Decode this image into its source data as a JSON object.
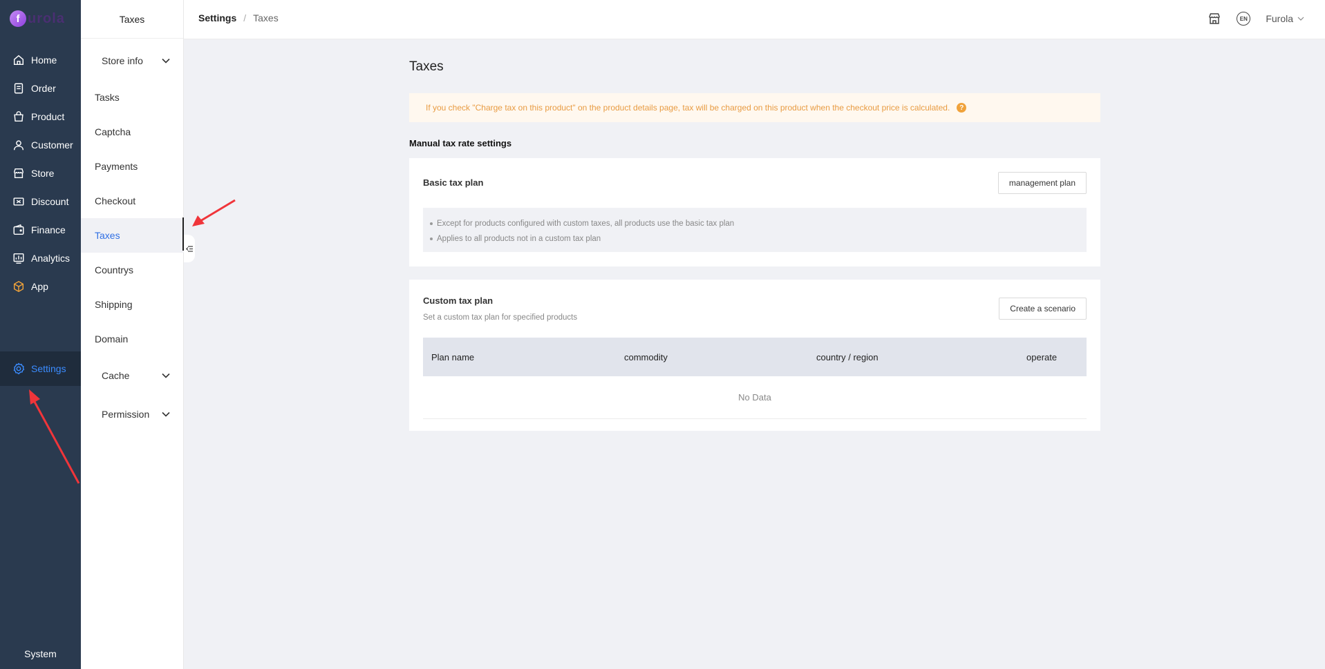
{
  "brand": {
    "logo_letter": "f",
    "logo_text": "urola"
  },
  "nav": {
    "items": [
      {
        "label": "Home",
        "icon": "home-icon"
      },
      {
        "label": "Order",
        "icon": "order-icon"
      },
      {
        "label": "Product",
        "icon": "bag-icon"
      },
      {
        "label": "Customer",
        "icon": "user-icon"
      },
      {
        "label": "Store",
        "icon": "store-icon"
      },
      {
        "label": "Discount",
        "icon": "discount-icon"
      },
      {
        "label": "Finance",
        "icon": "wallet-icon"
      },
      {
        "label": "Analytics",
        "icon": "analytics-icon"
      },
      {
        "label": "App",
        "icon": "cube-icon"
      },
      {
        "label": "Settings",
        "icon": "gear-icon",
        "active": true
      }
    ],
    "system_label": "System"
  },
  "submenu": {
    "title": "Taxes",
    "items": [
      {
        "label": "Store info",
        "expandable": true
      },
      {
        "label": "Tasks"
      },
      {
        "label": "Captcha"
      },
      {
        "label": "Payments"
      },
      {
        "label": "Checkout"
      },
      {
        "label": "Taxes",
        "active": true
      },
      {
        "label": "Countrys"
      },
      {
        "label": "Shipping"
      },
      {
        "label": "Domain"
      },
      {
        "label": "Cache",
        "expandable": true
      },
      {
        "label": "Permission",
        "expandable": true
      }
    ]
  },
  "header": {
    "breadcrumb": [
      "Settings",
      "Taxes"
    ],
    "user": "Furola",
    "lang_badge": "EN"
  },
  "main": {
    "title": "Taxes",
    "notice": "If you check \"Charge tax on this product\" on the product details page, tax will be charged on this product when the checkout price is calculated.",
    "notice_help": "?",
    "section_title": "Manual tax rate settings",
    "basic_plan": {
      "title": "Basic tax plan",
      "button": "management plan",
      "bullets": [
        "Except for products configured with custom taxes, all products use the basic tax plan",
        "Applies to all products not in a custom tax plan"
      ]
    },
    "custom_plan": {
      "title": "Custom tax plan",
      "subtitle": "Set a custom tax plan for specified products",
      "button": "Create a scenario",
      "columns": [
        "Plan name",
        "commodity",
        "country / region",
        "operate"
      ],
      "empty_text": "No Data"
    }
  },
  "colors": {
    "nav_bg": "#2a3a4f",
    "accent": "#3b8cff",
    "notice_text": "#e89b42",
    "arrow": "#f0353a"
  }
}
